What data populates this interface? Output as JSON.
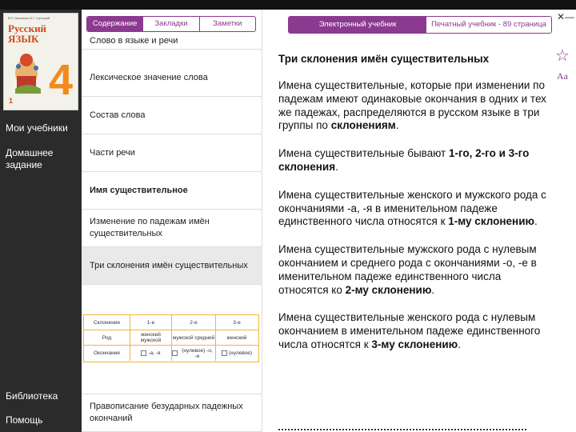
{
  "sidebar": {
    "book": {
      "authors": "В.П. Канакина  В.Г. Горецкий",
      "title_line1": "Русский",
      "title_line2": "язык",
      "grade": "4",
      "part": "1"
    },
    "items": [
      {
        "label": "Мои учебники"
      },
      {
        "label": "Домашнее задание"
      },
      {
        "label": "Библиотека"
      },
      {
        "label": "Помощь"
      }
    ]
  },
  "toc": {
    "tabs": [
      {
        "label": "Содержание"
      },
      {
        "label": "Закладки"
      },
      {
        "label": "Заметки"
      }
    ],
    "items": [
      {
        "label": "Слово в языке и речи"
      },
      {
        "label": "Лексическое значение слова"
      },
      {
        "label": "Состав слова"
      },
      {
        "label": "Части речи"
      },
      {
        "label": "Имя существительное"
      },
      {
        "label": "Изменение по падежам имён существительных"
      },
      {
        "label": "Три склонения имён существительных"
      },
      {
        "label": "Правописание безударных падежных окончаний"
      }
    ]
  },
  "declension_table": {
    "headers": [
      "Склонение",
      "1-е",
      "2-е",
      "3-е"
    ],
    "rows": [
      {
        "label": "Род",
        "cells": [
          "женский мужской",
          "мужской средний",
          "женский"
        ]
      },
      {
        "label": "Окончание",
        "cells": [
          "-а, -я",
          "(нулевое) -о, -е",
          "(нулевое)"
        ]
      }
    ]
  },
  "content": {
    "tabs": {
      "active": "Электронный учебник",
      "other": "Печатный учебник - 89 страница"
    },
    "font_button": "Aa",
    "title": "Три склонения имён существительных",
    "paragraphs": [
      {
        "text": "Имена существительные, которые при изменении по падежам имеют одинаковые окончания в одних и тех же падежах, распределяются в русском языке в три группы по ",
        "bold": "склонениям",
        "end": "."
      },
      {
        "text": "Имена существительные бывают ",
        "bold": "1-го, 2-го и 3-го склонения",
        "end": "."
      },
      {
        "text": "Имена существительные женского и мужского рода с окончаниями -а, -я в именительном падеже единственного числа относятся к ",
        "bold": "1-му склонению",
        "end": "."
      },
      {
        "text": "Имена существительные мужского рода с нулевым окончанием и среднего рода с окончаниями -о, -е в именительном падеже единственного числа относятся ко ",
        "bold": "2-му склонению",
        "end": "."
      },
      {
        "text": "Имена существительные женского рода с нулевым окончанием в именительном падеже единственного числа относятся к ",
        "bold": "3-му склонению",
        "end": "."
      }
    ]
  },
  "colors": {
    "accent": "#8b3a8f",
    "sidebar_bg": "#2b2b2b",
    "table_border": "#f0b63c",
    "selected_row": "#e9e9e9"
  }
}
